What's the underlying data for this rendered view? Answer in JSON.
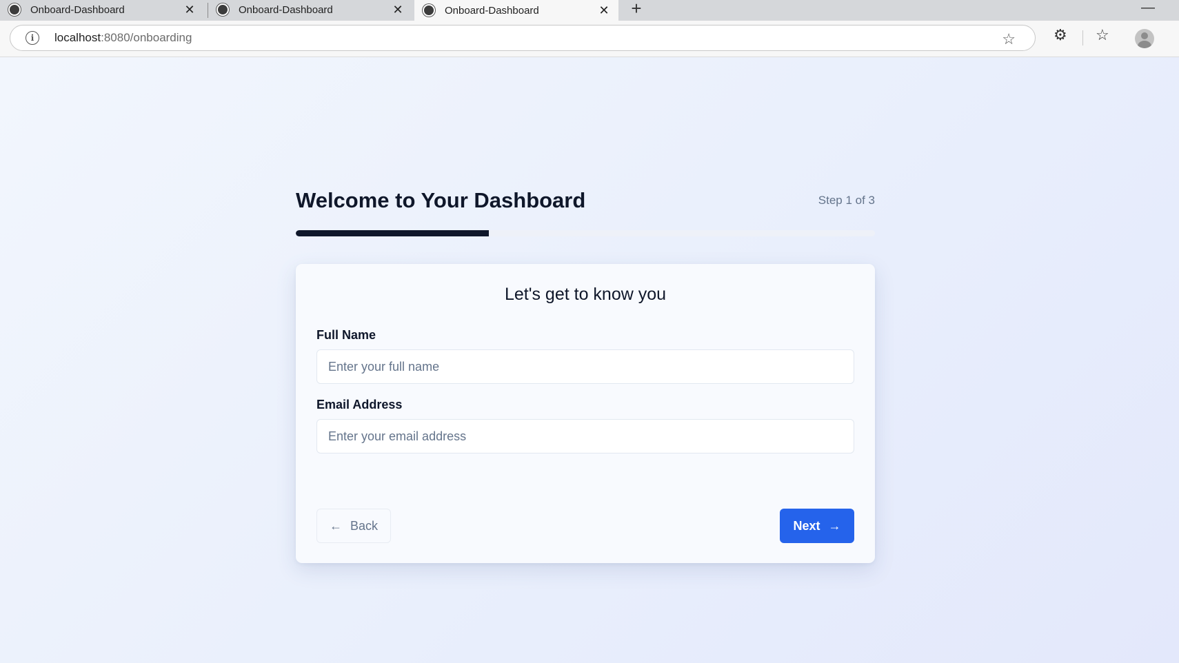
{
  "browser": {
    "tabs": [
      {
        "title": "Onboard-Dashboard",
        "active": false
      },
      {
        "title": "Onboard-Dashboard",
        "active": false
      },
      {
        "title": "Onboard-Dashboard",
        "active": true
      }
    ],
    "url_host": "localhost",
    "url_rest": ":8080/onboarding",
    "icons": [
      "info-icon",
      "star-icon",
      "extensions-icon",
      "favorites-icon",
      "profile-avatar"
    ]
  },
  "header": {
    "title": "Welcome to Your Dashboard",
    "step_text": "Step 1 of 3",
    "progress_fraction": 0.333
  },
  "form": {
    "heading": "Let's get to know you",
    "fields": [
      {
        "label": "Full Name",
        "placeholder": "Enter your full name",
        "value": ""
      },
      {
        "label": "Email Address",
        "placeholder": "Enter your email address",
        "value": ""
      }
    ]
  },
  "actions": {
    "back_label": "Back",
    "next_label": "Next",
    "back_icon": "arrow-left-icon",
    "next_icon": "arrow-right-icon"
  },
  "colors": {
    "primary": "#2563eb",
    "progress": "#0f172a",
    "text": "#0f172a",
    "muted": "#64748b"
  }
}
